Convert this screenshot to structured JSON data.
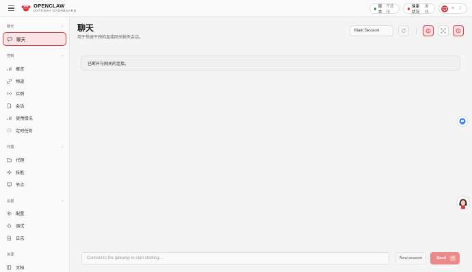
{
  "header": {
    "brand_title": "OPENCLAW",
    "brand_subtitle": "GATEWAY DASHBOARD",
    "version_label": "版本",
    "version_value": "不适用",
    "health_label": "健康状况",
    "health_value": "离线",
    "version_dot_color": "#2e9e4f",
    "health_dot_color": "#d9363e"
  },
  "sidebar": {
    "chat_section": "聊天",
    "chat_item": "聊天",
    "control_section": "控制",
    "control_items": [
      "概览",
      "频道",
      "实例",
      "会话",
      "使用情况",
      "定时任务"
    ],
    "agent_section": "代理",
    "agent_items": [
      "代理",
      "技能",
      "节点"
    ],
    "settings_section": "设置",
    "settings_items": [
      "配置",
      "调试",
      "日志"
    ],
    "resources_section": "资源",
    "resources_items": [
      "文档"
    ]
  },
  "main": {
    "title": "聊天",
    "subtitle": "用于快速干预的直接网关聊天会话。",
    "session_select_value": "Main Session",
    "notice": "已断开与网关的连接。",
    "composer_placeholder": "Connect to the gateway to start chatting...",
    "new_session_label": "New session",
    "send_label": "Send",
    "send_shortcut": "⏎"
  },
  "colors": {
    "accent": "#d9363e",
    "accent_soft": "#fbe3e4",
    "send_button": "#ec8a8a",
    "chat_bubble_icon": "#3b82f6"
  }
}
